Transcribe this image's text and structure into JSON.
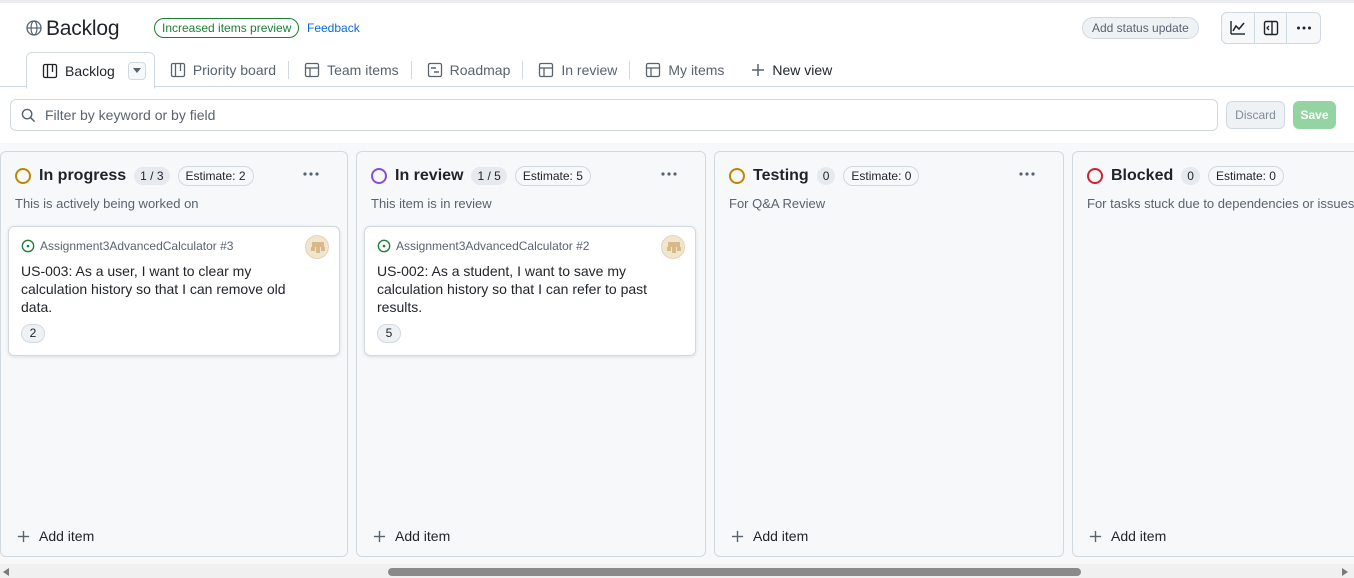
{
  "project": {
    "title": "Backlog",
    "preview_badge": "Increased items preview",
    "feedback_link": "Feedback",
    "status_update_button": "Add status update",
    "icons": [
      "insights-icon",
      "side-panel-icon",
      "kebab-menu-icon"
    ]
  },
  "tabs": [
    {
      "label": "Backlog",
      "icon": "board-icon",
      "active": true
    },
    {
      "label": "Priority board",
      "icon": "board-icon"
    },
    {
      "label": "Team items",
      "icon": "table-icon"
    },
    {
      "label": "Roadmap",
      "icon": "roadmap-icon"
    },
    {
      "label": "In review",
      "icon": "table-icon"
    },
    {
      "label": "My items",
      "icon": "table-icon"
    },
    {
      "label": "New view",
      "icon": "plus-icon"
    }
  ],
  "filter": {
    "placeholder": "Filter by keyword or by field",
    "discard_label": "Discard",
    "save_label": "Save"
  },
  "columns": [
    {
      "name": "In progress",
      "count": "1 / 3",
      "estimate": "Estimate: 2",
      "description": "This is actively being worked on",
      "color": "#bf8700",
      "card": {
        "repo": "Assignment3AdvancedCalculator #3",
        "title": "US-003: As a user, I want to clear my calculation history so that I can remove old data.",
        "estimate": "2"
      },
      "add_item": "Add item"
    },
    {
      "name": "In review",
      "count": "1 / 5",
      "estimate": "Estimate: 5",
      "description": "This item is in review",
      "color": "#8250df",
      "card": {
        "repo": "Assignment3AdvancedCalculator #2",
        "title": "US-002: As a student, I want to save my calculation history so that I can refer to past results.",
        "estimate": "5"
      },
      "add_item": "Add item"
    },
    {
      "name": "Testing",
      "count": "0",
      "estimate": "Estimate: 0",
      "description": "For Q&A Review",
      "color": "#bf8700",
      "add_item": "Add item"
    },
    {
      "name": "Blocked",
      "count": "0",
      "estimate": "Estimate: 0",
      "description": "For tasks stuck due to dependencies or issues",
      "color": "#cf222e",
      "add_item": "Add item"
    }
  ]
}
